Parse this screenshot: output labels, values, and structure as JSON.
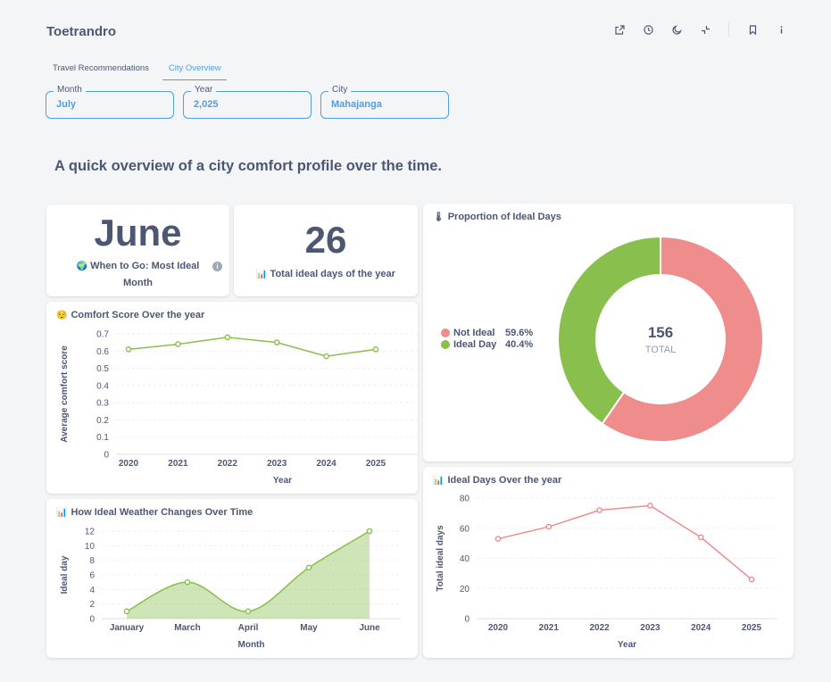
{
  "app": {
    "title": "Toetrandro"
  },
  "toolbar": {
    "icons": [
      "share-icon",
      "clock-icon",
      "moon-icon",
      "collapse-icon",
      "bookmark-icon",
      "info-icon"
    ]
  },
  "tabs": [
    {
      "label": "Travel Recommendations",
      "active": false
    },
    {
      "label": "City Overview",
      "active": true
    }
  ],
  "filters": {
    "month": {
      "label": "Month",
      "value": "July"
    },
    "year": {
      "label": "Year",
      "value": "2,025"
    },
    "city": {
      "label": "City",
      "value": "Mahajanga"
    }
  },
  "subtitle": "A quick overview of a city comfort profile over the time.",
  "kpi_month": {
    "value": "June",
    "label": "When to Go: Most Ideal Month",
    "emoji": "🌍"
  },
  "kpi_days": {
    "value": "26",
    "label": "Total ideal days of the year",
    "emoji": "📊"
  },
  "comfort": {
    "title": "Comfort Score Over the year",
    "emoji": "😌"
  },
  "weather": {
    "title": "How Ideal Weather Changes Over Time",
    "emoji": "📊"
  },
  "proportion": {
    "title": "Proportion of Ideal Days",
    "emoji": "🌡",
    "total_label": "TOTAL"
  },
  "ideal_days": {
    "title": "Ideal Days Over the year",
    "emoji": "📊"
  },
  "colors": {
    "accent": "#509ee3",
    "green": "#88bf4d",
    "pink": "#ef8c8c",
    "text": "#4c5773"
  },
  "chart_data": [
    {
      "id": "comfort",
      "type": "line",
      "x": [
        "2020",
        "2021",
        "2022",
        "2023",
        "2024",
        "2025"
      ],
      "series": [
        {
          "values": [
            0.61,
            0.64,
            0.68,
            0.65,
            0.57,
            0.61
          ]
        }
      ],
      "xlabel": "Year",
      "ylabel": "Average comfort score",
      "yticks": [
        "0",
        "0.1",
        "0.2",
        "0.3",
        "0.4",
        "0.5",
        "0.6",
        "0.7"
      ],
      "ylim": [
        0,
        0.7
      ],
      "color": "#88bf4d"
    },
    {
      "id": "weather",
      "type": "area",
      "x": [
        "January",
        "March",
        "April",
        "May",
        "June"
      ],
      "series": [
        {
          "values": [
            1,
            5,
            1,
            7,
            12
          ]
        }
      ],
      "xlabel": "Month",
      "ylabel": "Ideal day",
      "yticks": [
        "0",
        "2",
        "4",
        "6",
        "8",
        "10",
        "12"
      ],
      "ylim": [
        0,
        12
      ],
      "color": "#88bf4d"
    },
    {
      "id": "proportion",
      "type": "pie",
      "categories": [
        "Not Ideal",
        "Ideal Day"
      ],
      "values": [
        93,
        63
      ],
      "percents": [
        "59.6%",
        "40.4%"
      ],
      "total": "156",
      "colors": [
        "#ef8c8c",
        "#88bf4d"
      ]
    },
    {
      "id": "ideal_days",
      "type": "line",
      "x": [
        "2020",
        "2021",
        "2022",
        "2023",
        "2024",
        "2025"
      ],
      "series": [
        {
          "values": [
            53,
            61,
            72,
            75,
            54,
            26
          ]
        }
      ],
      "xlabel": "Year",
      "ylabel": "Total ideal days",
      "yticks": [
        "0",
        "20",
        "40",
        "60",
        "80"
      ],
      "ylim": [
        0,
        80
      ],
      "color": "#ef8c8c"
    }
  ]
}
